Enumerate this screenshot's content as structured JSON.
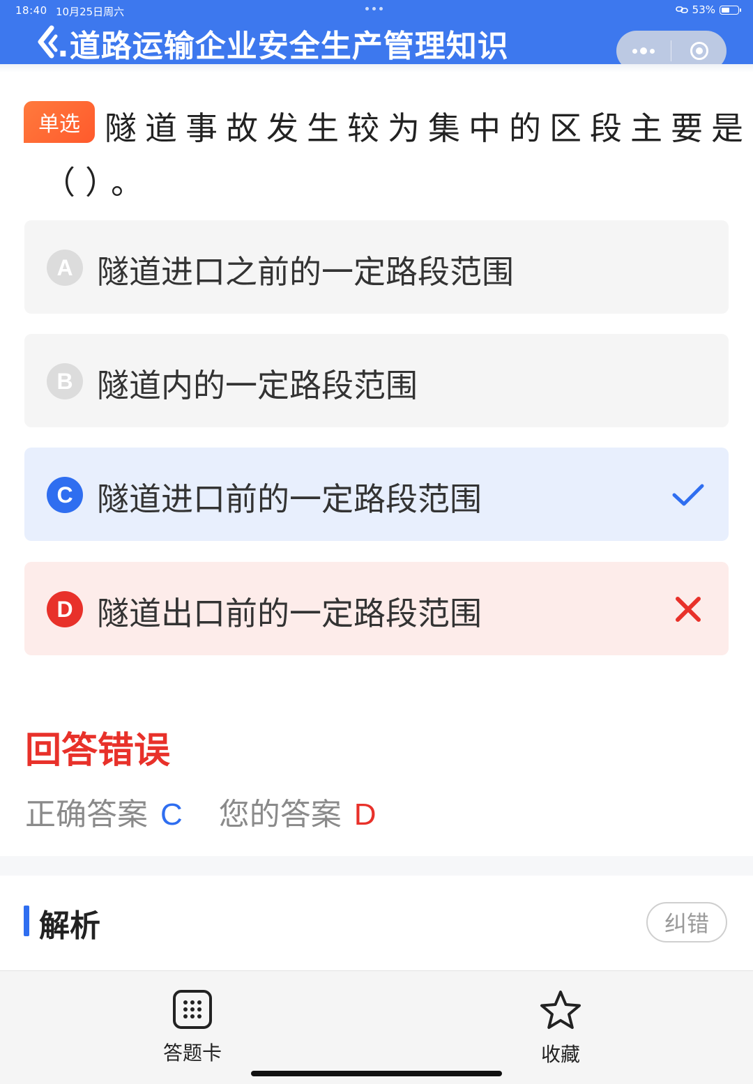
{
  "status_bar": {
    "time": "18:40",
    "date": "10月25日周六",
    "battery": "53%",
    "battery_level": 0.53
  },
  "header": {
    "title": ".道路运输企业安全生产管理知识"
  },
  "question": {
    "type_tag": "单选",
    "text_line1": "隧道事故发生较为集中的区段主要是",
    "text_line2": "（）。"
  },
  "options": [
    {
      "letter": "A",
      "text": "隧道进口之前的一定路段范围",
      "state": "normal"
    },
    {
      "letter": "B",
      "text": "隧道内的一定路段范围",
      "state": "normal"
    },
    {
      "letter": "C",
      "text": "隧道进口前的一定路段范围",
      "state": "correct"
    },
    {
      "letter": "D",
      "text": "隧道出口前的一定路段范围",
      "state": "wrong"
    }
  ],
  "result": {
    "title": "回答错误",
    "correct_label": "正确答案",
    "correct_value": "C",
    "your_label": "您的答案",
    "your_value": "D"
  },
  "analysis": {
    "title": "解析",
    "report_button": "纠错"
  },
  "bottom_nav": {
    "answer_card": "答题卡",
    "favorite": "收藏"
  },
  "colors": {
    "header_blue": "#3d78ee",
    "correct_blue": "#2f6ef0",
    "wrong_red": "#e8312a",
    "tag_orange": "#ff6a33"
  }
}
